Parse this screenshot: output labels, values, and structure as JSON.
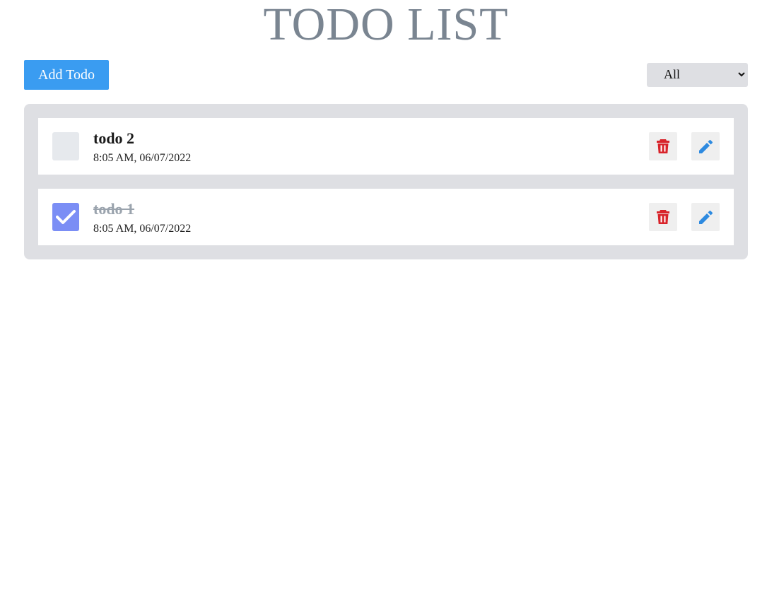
{
  "header": {
    "title": "TODO LIST"
  },
  "toolbar": {
    "add_label": "Add Todo",
    "filter_selected": "All"
  },
  "colors": {
    "primary": "#3a9cf1",
    "checked": "#7b8ef5",
    "delete_icon": "#d8232a",
    "edit_icon": "#2d8ae0",
    "title_gray": "#7a8591",
    "panel_bg": "#dedfe3"
  },
  "todos": [
    {
      "title": "todo 2",
      "time": "8:05 AM, 06/07/2022",
      "completed": false
    },
    {
      "title": "todo 1",
      "time": "8:05 AM, 06/07/2022",
      "completed": true
    }
  ],
  "icons": {
    "delete": "trash-icon",
    "edit": "pencil-icon",
    "check": "check-icon",
    "dropdown": "chevron-down-icon"
  }
}
